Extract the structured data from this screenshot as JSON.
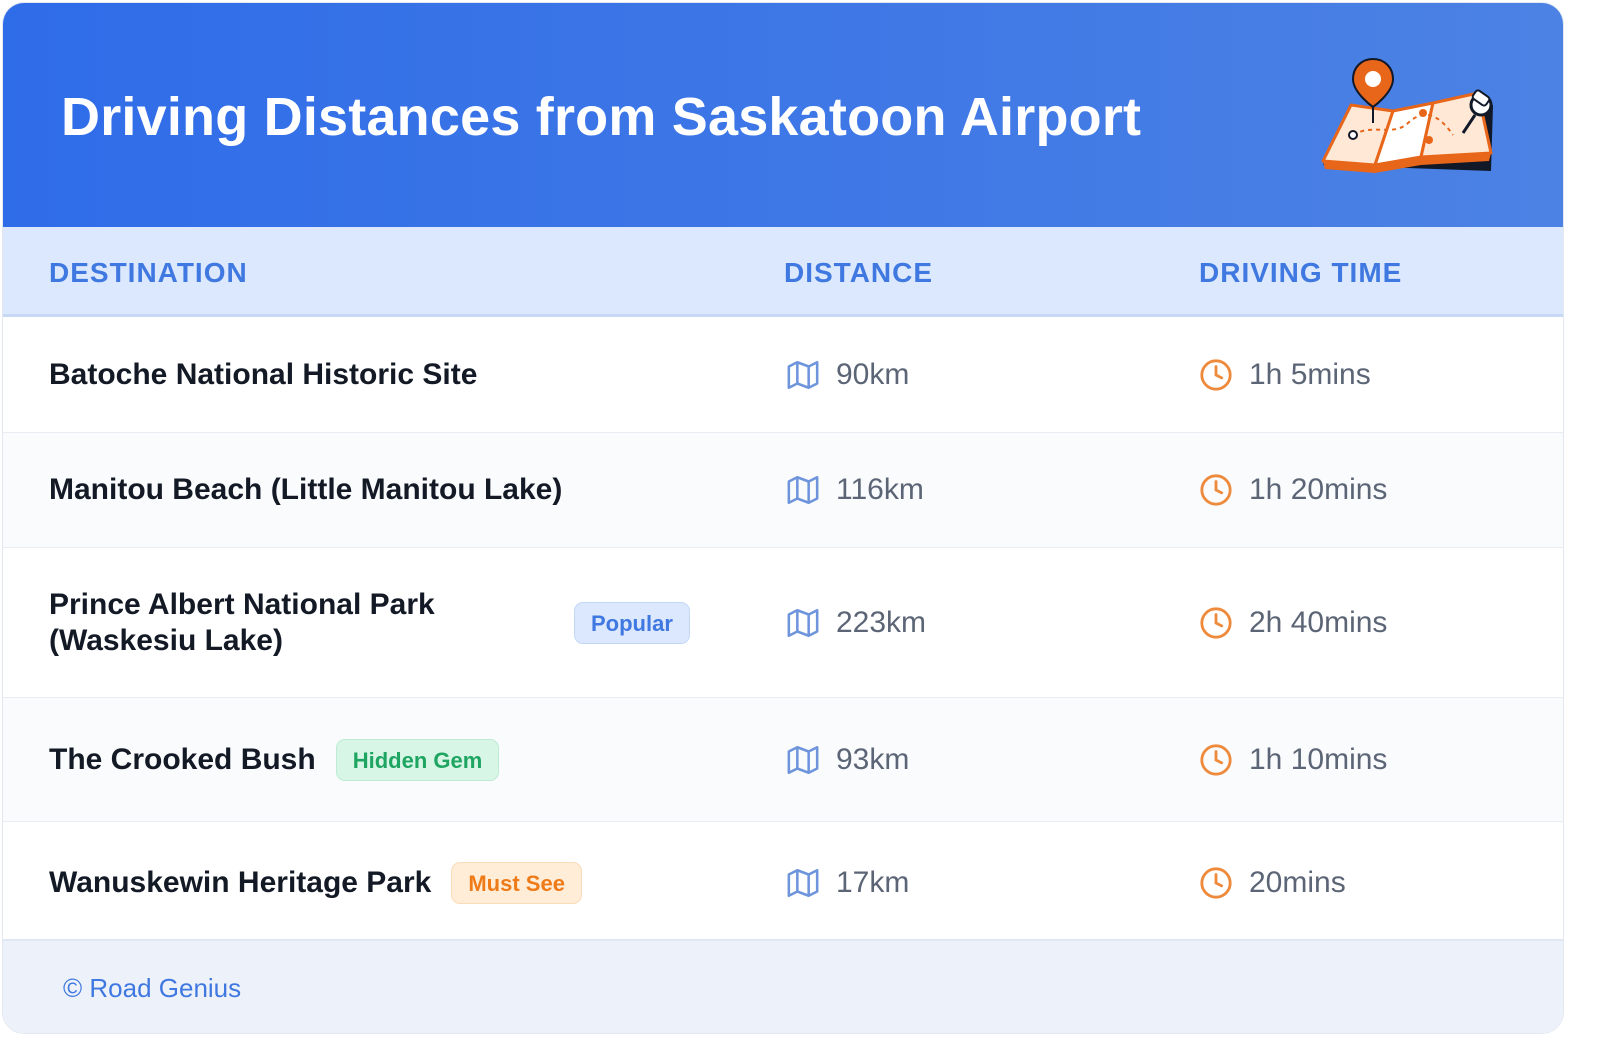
{
  "header": {
    "title": "Driving Distances from Saskatoon Airport",
    "illustration": "map-with-pins-illustration"
  },
  "columns": {
    "destination": "DESTINATION",
    "distance": "DISTANCE",
    "driving_time": "DRIVING TIME"
  },
  "rows": [
    {
      "destination": "Batoche National Historic Site",
      "badge": "",
      "distance": "90km",
      "time": "1h 5mins"
    },
    {
      "destination": "Manitou Beach (Little Manitou Lake)",
      "badge": "",
      "distance": "116km",
      "time": "1h 20mins"
    },
    {
      "destination": "Prince Albert National Park (Waskesiu Lake)",
      "badge": "Popular",
      "distance": "223km",
      "time": "2h 40mins"
    },
    {
      "destination": "The Crooked Bush",
      "badge": "Hidden Gem",
      "distance": "93km",
      "time": "1h 10mins"
    },
    {
      "destination": "Wanuskewin Heritage Park",
      "badge": "Must See",
      "distance": "17km",
      "time": "20mins"
    }
  ],
  "icons": {
    "distance": "map-icon",
    "time": "clock-icon"
  },
  "colors": {
    "header_blue": "#2f6ce8",
    "accent_blue": "#3f78e0",
    "clock_orange": "#ee8a3c",
    "badge_popular": "#dbe8fd",
    "badge_hidden_gem": "#d8f6e6",
    "badge_must_see": "#ffedd8"
  },
  "footer": {
    "credit": "© Road Genius"
  }
}
